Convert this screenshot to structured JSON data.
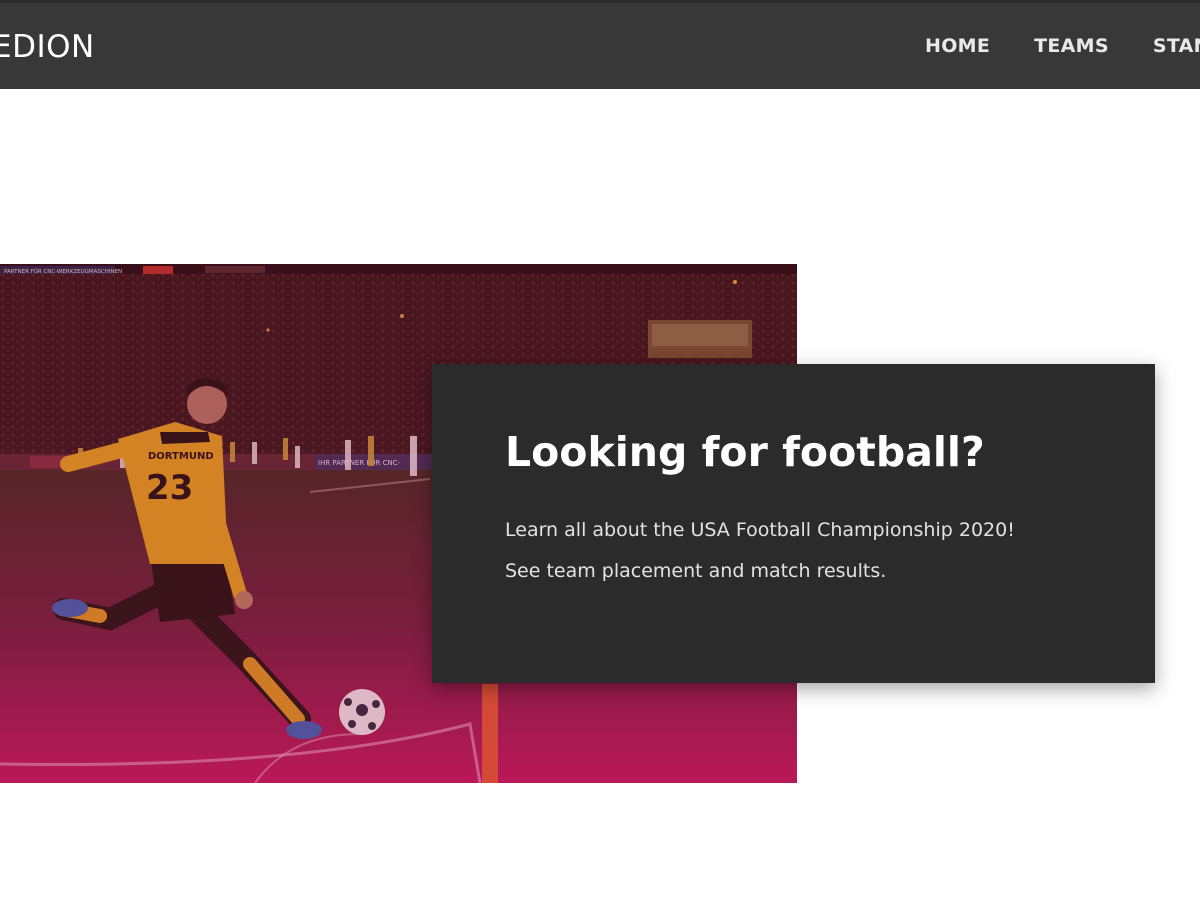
{
  "header": {
    "brand": "EDION",
    "nav": [
      "HOME",
      "TEAMS",
      "STAN"
    ]
  },
  "hero": {
    "image": "football-player-taking-corner-kick",
    "overlay_color": "#c8185e",
    "signage": {
      "left_banner": "PARTNER FÜR CNC-WERKZEUGMASCHINEN",
      "ad_board": "IHR PARTNER FÜR CNC-",
      "jersey_name": "DORTMUND",
      "jersey_number": "23"
    }
  },
  "card": {
    "title": "Looking for football?",
    "line1": "Learn all about the USA Football Championship 2020!",
    "line2": "See team placement and match results."
  },
  "colors": {
    "topbar": "#383838",
    "card": "#2b2b2b",
    "accent_magenta": "#c8185e"
  }
}
